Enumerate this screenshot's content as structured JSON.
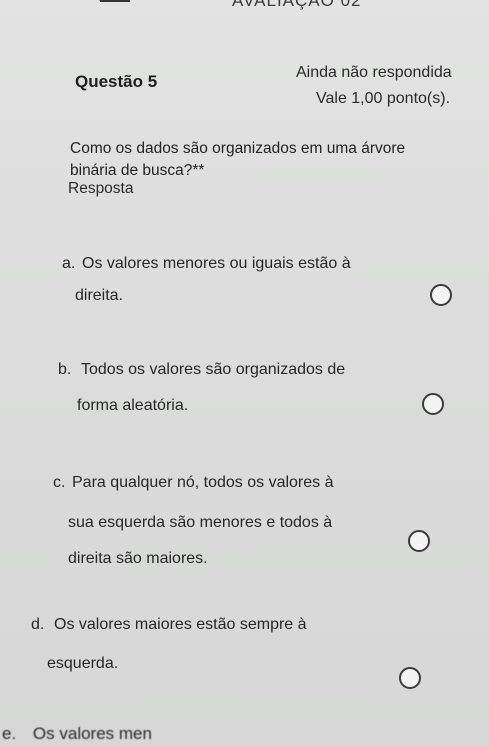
{
  "header": {
    "title": "AVALIAÇÃO 02"
  },
  "question": {
    "number_label": "Questão 5",
    "status": "Ainda não respondida",
    "points": "Vale 1,00 ponto(s).",
    "text_line1": "Como os dados são organizados em uma árvore",
    "text_line2": "binária de busca?**"
  },
  "answer_label": "Resposta",
  "options": [
    {
      "letter": "a.",
      "lines": [
        "Os valores menores ou iguais estão à",
        "direita."
      ]
    },
    {
      "letter": "b.",
      "lines": [
        "Todos os valores são organizados de",
        "forma aleatória."
      ]
    },
    {
      "letter": "c.",
      "lines": [
        "Para qualquer nó, todos os valores à",
        "sua esquerda são menores e todos à",
        "direita são maiores."
      ]
    },
    {
      "letter": "d.",
      "lines": [
        "Os valores maiores estão sempre à",
        "esquerda."
      ]
    },
    {
      "letter": "e.",
      "lines": [
        "Os valores men"
      ]
    }
  ],
  "icons": {
    "back": "arrow-left-icon",
    "radio": "radio-unchecked-icon"
  },
  "colors": {
    "background": "#dcdddc",
    "text": "#2b2b2b"
  }
}
